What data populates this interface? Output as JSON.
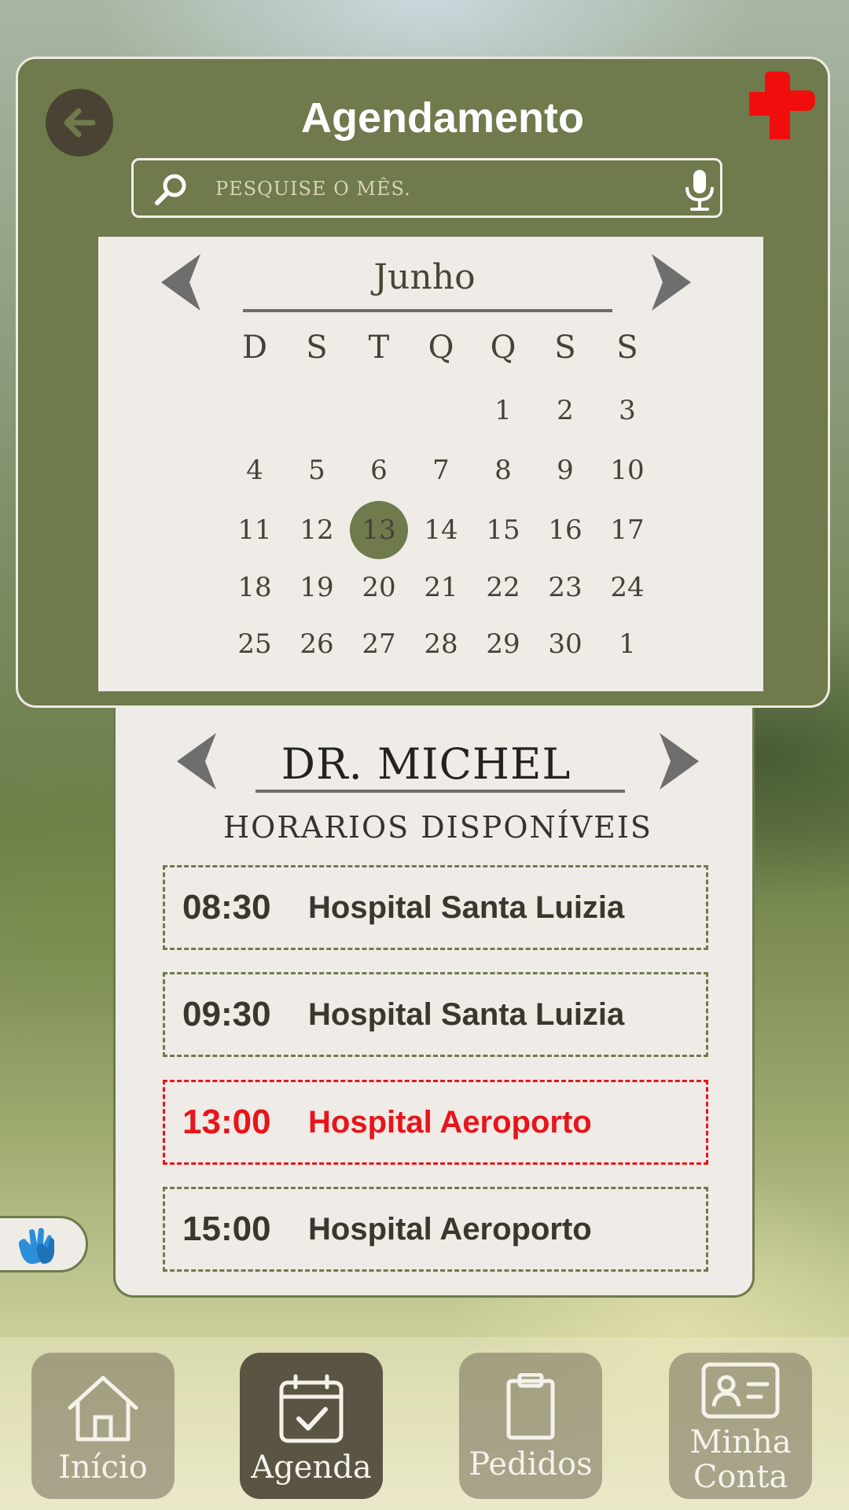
{
  "header": {
    "title": "Agendamento",
    "back_icon": "arrow-left-icon",
    "logo_icon": "red-cross-icon"
  },
  "search": {
    "placeholder": "PESQUISE O MÊS.",
    "search_icon": "search-icon",
    "mic_icon": "microphone-icon"
  },
  "calendar": {
    "month": "Junho",
    "weekdays": [
      "D",
      "S",
      "T",
      "Q",
      "Q",
      "S",
      "S"
    ],
    "weeks": [
      [
        "",
        "",
        "",
        "",
        "1",
        "2",
        "3"
      ],
      [
        "4",
        "5",
        "6",
        "7",
        "8",
        "9",
        "10"
      ],
      [
        "11",
        "12",
        "13",
        "14",
        "15",
        "16",
        "17"
      ],
      [
        "18",
        "19",
        "20",
        "21",
        "22",
        "23",
        "24"
      ],
      [
        "25",
        "26",
        "27",
        "28",
        "29",
        "30",
        "1"
      ]
    ],
    "selected_day": "13"
  },
  "doctor": {
    "name": "DR. MICHEL",
    "subtitle": "HORARIOS DISPONÍVEIS",
    "slots": [
      {
        "time": "08:30",
        "place": "Hospital Santa Luizia",
        "highlighted": false
      },
      {
        "time": "09:30",
        "place": "Hospital Santa Luizia",
        "highlighted": false
      },
      {
        "time": "13:00",
        "place": "Hospital Aeroporto",
        "highlighted": true
      },
      {
        "time": "15:00",
        "place": "Hospital Aeroporto",
        "highlighted": false
      }
    ]
  },
  "accessibility": {
    "icon": "sign-language-icon"
  },
  "nav": {
    "items": [
      {
        "label": "Início",
        "icon": "home-icon",
        "active": false
      },
      {
        "label": "Agenda",
        "icon": "calendar-check-icon",
        "active": true
      },
      {
        "label": "Pedidos",
        "icon": "clipboard-icon",
        "active": false
      },
      {
        "label": "Minha Conta",
        "icon": "id-card-icon",
        "active": false
      }
    ]
  },
  "colors": {
    "olive": "#6f7a4d",
    "cream": "#efebe6",
    "highlight_red": "#e8141b",
    "dark_brown": "#4a4333"
  }
}
